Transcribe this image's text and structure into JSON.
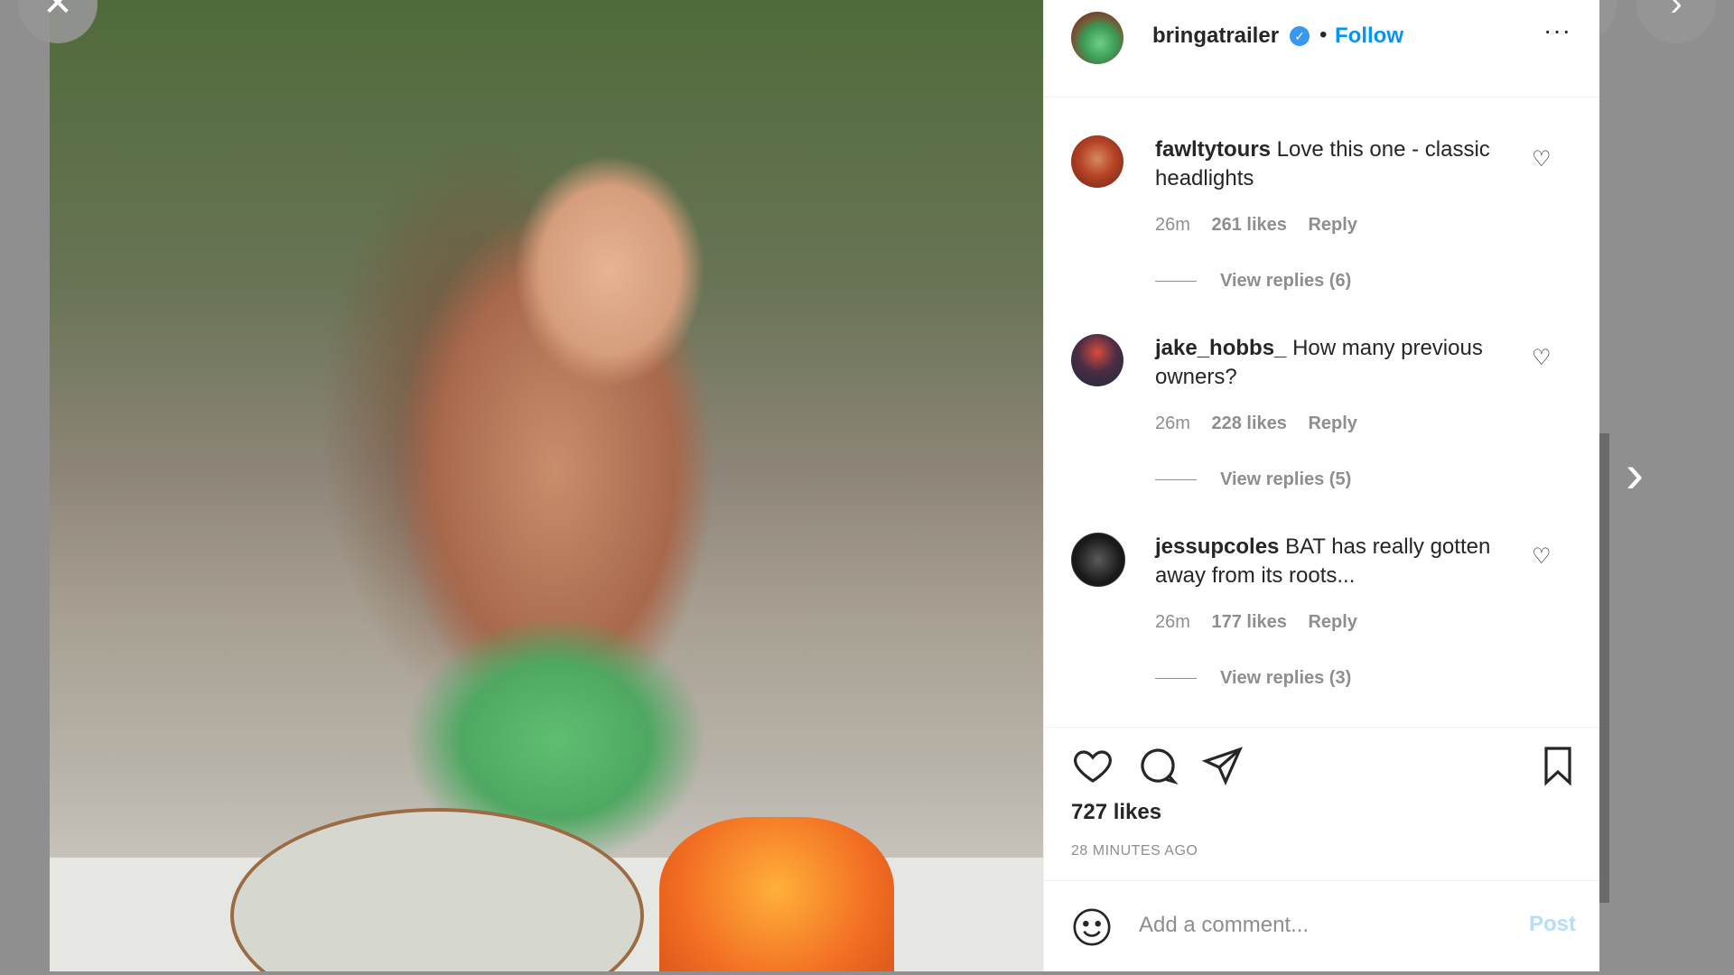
{
  "post": {
    "username": "bringatrailer",
    "follow_label": "Follow",
    "more_label": "···",
    "separator": "•"
  },
  "comments": [
    {
      "user": "fawltytours",
      "text": " Love this one - classic headlights",
      "time": "26m",
      "likes": "261 likes",
      "reply": "Reply",
      "view_replies": "View replies (6)"
    },
    {
      "user": "jake_hobbs_",
      "text": " How many previous owners?",
      "time": "26m",
      "likes": "228 likes",
      "reply": "Reply",
      "view_replies": "View replies (5)"
    },
    {
      "user": "jessupcoles",
      "text": " BAT has really gotten away from its roots...",
      "time": "26m",
      "likes": "177 likes",
      "reply": "Reply",
      "view_replies": "View replies (3)"
    }
  ],
  "engagement": {
    "likes": "727 likes",
    "time_ago": "28 MINUTES AGO"
  },
  "comment_box": {
    "placeholder": "Add a comment...",
    "post_label": "Post"
  },
  "icons": {
    "close": "close-icon",
    "more": "more-vertical-icon",
    "prev": "chevron-left-icon",
    "next": "chevron-right-icon",
    "like": "heart-icon",
    "comment": "comment-icon",
    "share": "paper-plane-icon",
    "save": "bookmark-icon",
    "emoji": "emoji-icon",
    "verified": "verified-badge-icon"
  },
  "colors": {
    "link": "#0095f6",
    "post_disabled": "#b2dffc",
    "text": "#262626",
    "muted": "#8e8e8e"
  }
}
